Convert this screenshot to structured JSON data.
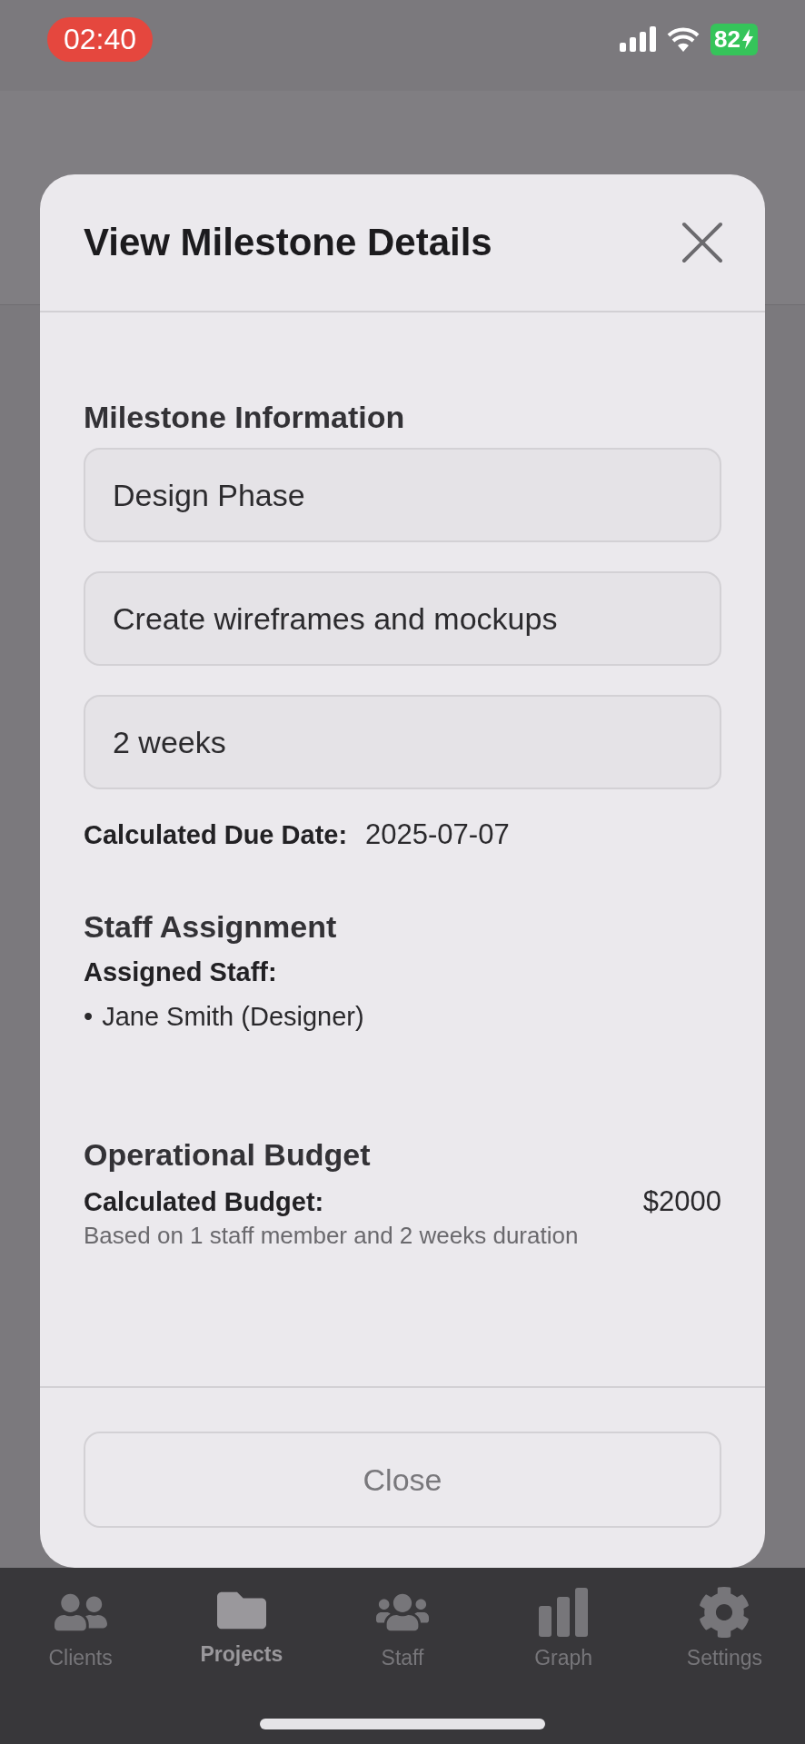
{
  "status_bar": {
    "time": "02:40",
    "battery": "82"
  },
  "modal": {
    "title": "View Milestone Details",
    "sections": [
      {
        "kind": "fields",
        "heading": "Milestone Information",
        "fields": [
          {
            "value": "Design Phase"
          },
          {
            "value": "Create wireframes and mockups"
          },
          {
            "value": "2 weeks"
          }
        ],
        "info": {
          "label": "Calculated Due Date:",
          "value": "2025-07-07"
        }
      },
      {
        "kind": "list",
        "heading": "Staff Assignment",
        "label": "Assigned Staff:",
        "items": [
          {
            "bullet": "•",
            "text": "Jane Smith (Designer)"
          }
        ]
      },
      {
        "kind": "budget",
        "heading": "Operational Budget",
        "label": "Calculated Budget:",
        "value": "$2000",
        "note": "Based on 1 staff member and 2 weeks duration"
      }
    ],
    "footer_button": "Close"
  },
  "tabs": [
    {
      "label": "Clients",
      "kind": "clients",
      "selected": false
    },
    {
      "label": "Projects",
      "kind": "projects",
      "selected": true
    },
    {
      "label": "Staff",
      "kind": "staff",
      "selected": false
    },
    {
      "label": "Graph",
      "kind": "graph",
      "selected": false
    },
    {
      "label": "Settings",
      "kind": "settings",
      "selected": false
    }
  ]
}
